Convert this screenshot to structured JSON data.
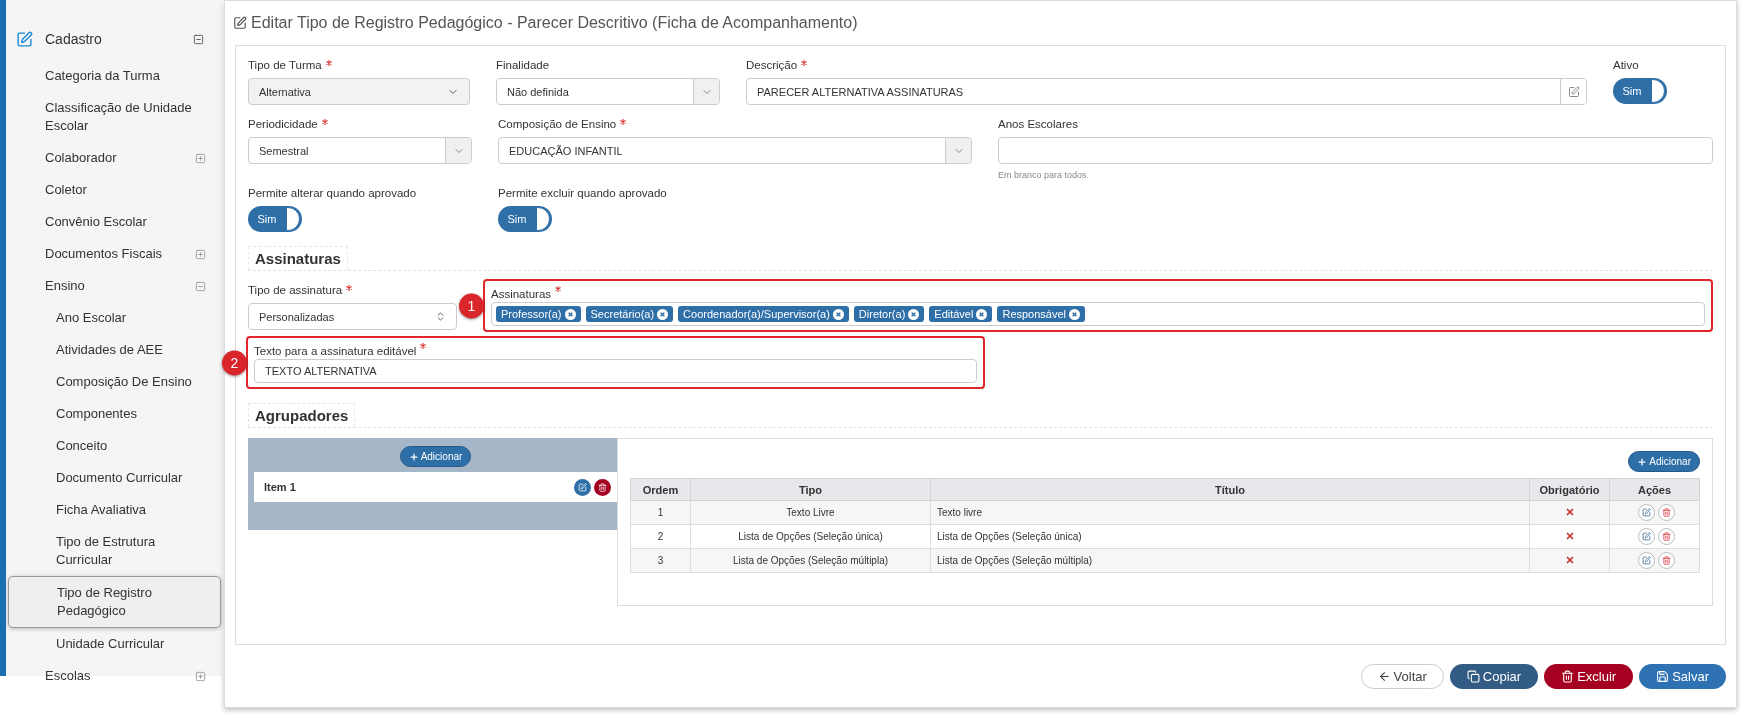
{
  "sidebar": {
    "title": "Cadastro",
    "expanded": true,
    "items": [
      {
        "label": "Categoria da Turma",
        "selected": false
      },
      {
        "label": "Classificação de Unidade Escolar",
        "selected": false
      },
      {
        "label": "Colaborador",
        "expanded": false,
        "selected": false
      },
      {
        "label": "Coletor",
        "selected": false
      },
      {
        "label": "Convênio Escolar",
        "selected": false
      },
      {
        "label": "Documentos Fiscais",
        "expanded": false,
        "selected": false
      },
      {
        "label": "Ensino",
        "expanded": true,
        "selected": false,
        "children": [
          {
            "label": "Ano Escolar",
            "selected": false
          },
          {
            "label": "Atividades de AEE",
            "selected": false
          },
          {
            "label": "Composição De Ensino",
            "selected": false
          },
          {
            "label": "Componentes",
            "selected": false
          },
          {
            "label": "Conceito",
            "selected": false
          },
          {
            "label": "Documento Curricular",
            "selected": false
          },
          {
            "label": "Ficha Avaliativa",
            "selected": false
          },
          {
            "label": "Tipo de Estrutura Curricular",
            "selected": false
          },
          {
            "label": "Tipo de Registro Pedagógico",
            "selected": true
          },
          {
            "label": "Unidade Curricular",
            "selected": false
          }
        ]
      },
      {
        "label": "Escolas",
        "expanded": false,
        "selected": false
      }
    ]
  },
  "page_title": "Editar Tipo de Registro Pedagógico - Parecer Descritivo (Ficha de Acompanhamento)",
  "form_rows": [
    [
      {
        "kind": "select",
        "label": "Tipo de Turma",
        "required": true,
        "value": "Alternativa",
        "disabled": true
      },
      {
        "kind": "select",
        "label": "Finalidade",
        "required": false,
        "value": "Não definida",
        "disabled": false
      },
      {
        "kind": "text",
        "label": "Descrição",
        "required": true,
        "value": "PARECER ALTERNATIVA ASSINATURAS",
        "disabled": false
      },
      {
        "kind": "toggle",
        "label": "Ativo",
        "required": false,
        "text": "Sim",
        "on": true
      }
    ],
    [
      {
        "kind": "select",
        "label": "Periodicidade",
        "required": true,
        "value": "Semestral",
        "disabled": false
      },
      {
        "kind": "select",
        "label": "Composição de Ensino",
        "required": true,
        "value": "EDUCAÇÃO INFANTIL",
        "disabled": false
      },
      {
        "kind": "text",
        "label": "Anos Escolares",
        "required": false,
        "hint": "Em branco para todos.",
        "disabled": false
      }
    ],
    [
      {
        "kind": "toggle",
        "label": "Permite alterar quando aprovado",
        "required": false,
        "text": "Sim",
        "on": true
      },
      {
        "kind": "toggle",
        "label": "Permite excluir quando aprovado",
        "required": false,
        "text": "Sim",
        "on": true
      }
    ]
  ],
  "assinaturas": {
    "title": "Assinaturas",
    "tipo": {
      "label": "Tipo de assinatura",
      "required": true,
      "value": "Personalizadas"
    },
    "lista": {
      "label": "Assinaturas",
      "required": true,
      "annotation": "1",
      "tags": [
        "Professor(a)",
        "Secretário(a)",
        "Coordenador(a)/Supervisor(a)",
        "Diretor(a)",
        "Editável",
        "Responsável"
      ]
    },
    "texto": {
      "label": "Texto para a assinatura editável",
      "required": true,
      "annotation": "2",
      "value": "TEXTO ALTERNATIVA"
    }
  },
  "agrupadores": {
    "title": "Agrupadores",
    "add_label": "Adicionar",
    "items": [
      {
        "label": "Item 1"
      }
    ],
    "table_add_label": "Adicionar",
    "table": {
      "columns": [
        "Ordem",
        "Tipo",
        "Título",
        "Obrigatório",
        "Ações"
      ],
      "rows": [
        {
          "ordem": "1",
          "tipo": "Texto Livre",
          "titulo": "Texto livre",
          "required": false
        },
        {
          "ordem": "2",
          "tipo": "Lista de Opções (Seleção única)",
          "titulo": "Lista de Opções (Seleção única)",
          "required": false
        },
        {
          "ordem": "3",
          "tipo": "Lista de Opções (Seleção múltipla)",
          "titulo": "Lista de Opções (Seleção múltipla)",
          "required": false
        }
      ]
    }
  },
  "footer_buttons": [
    {
      "label": "Voltar",
      "kind": "back"
    },
    {
      "label": "Copiar",
      "kind": "copy"
    },
    {
      "label": "Excluir",
      "kind": "delete"
    },
    {
      "label": "Salvar",
      "kind": "save"
    }
  ]
}
